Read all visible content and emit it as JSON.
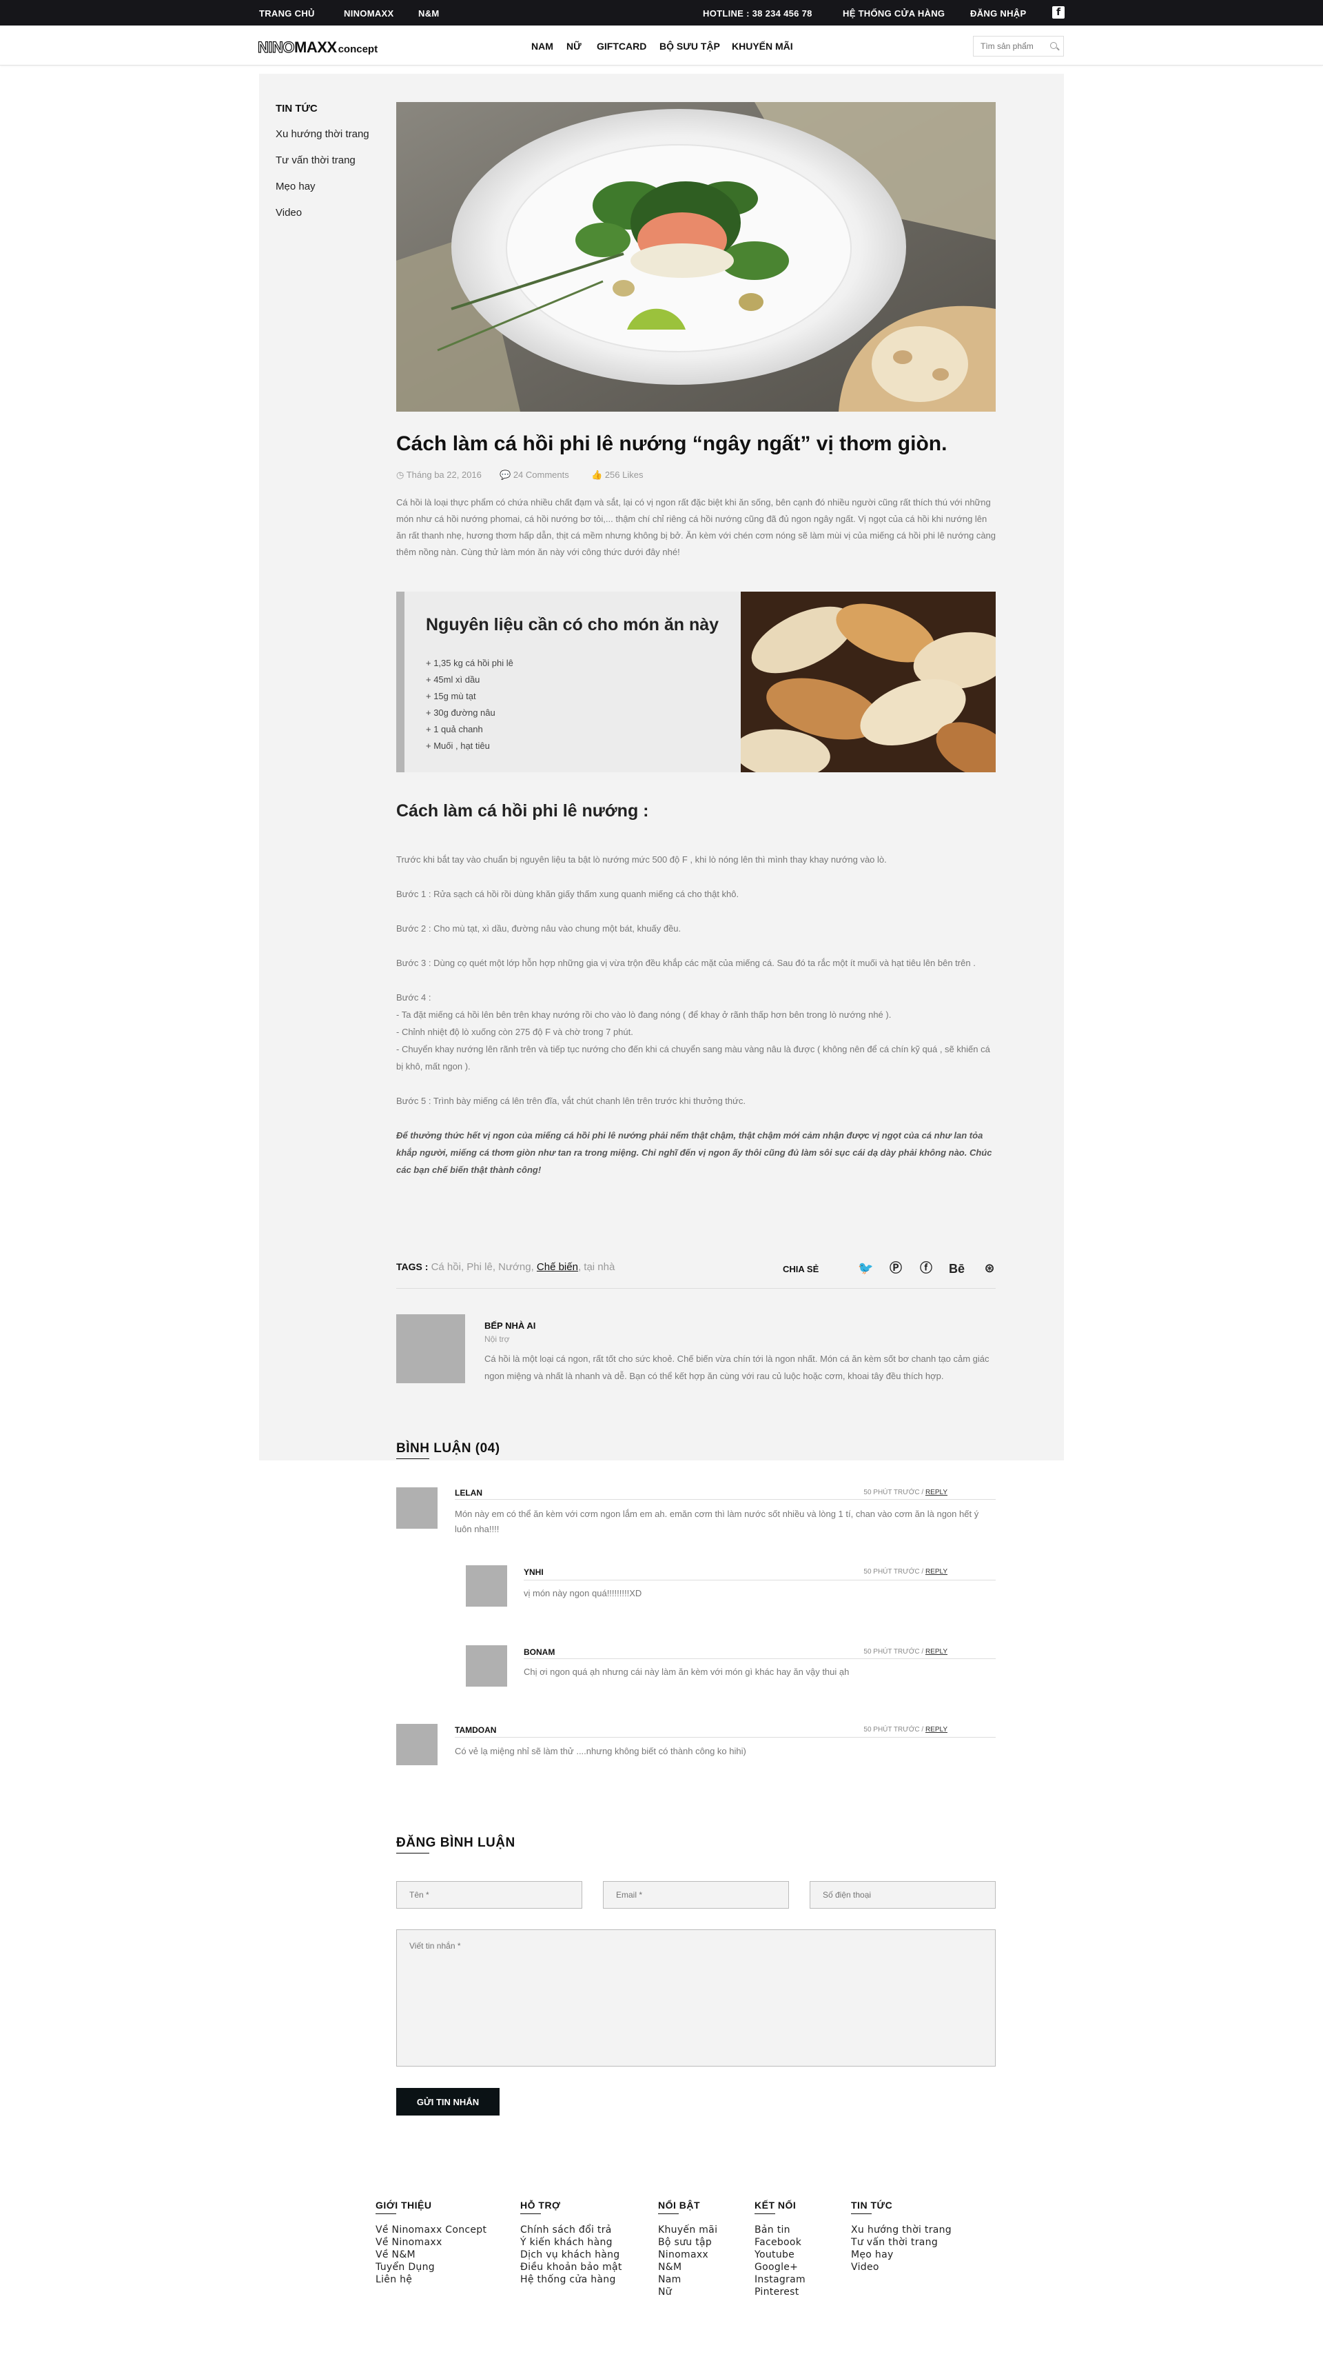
{
  "topbar": {
    "nav": [
      "TRANG CHỦ",
      "NINOMAXX",
      "N&M"
    ],
    "hotline": "HOTLINE : 38 234 456 78",
    "stores": "HỆ THỐNG CỬA HÀNG",
    "login": "ĐĂNG NHẬP",
    "social_icon": "facebook-icon"
  },
  "header": {
    "logo_outline": "NINO",
    "logo_bold": "MAXX",
    "logo_suffix": "concept",
    "nav": [
      "NAM",
      "NỮ",
      "GIFTCARD",
      "BỘ SƯU TẬP",
      "KHUYẾN MÃI"
    ],
    "search_placeholder": "Tìm sản phẩm"
  },
  "sidebar": {
    "title": "TIN TỨC",
    "items": [
      "Xu hướng thời trang",
      "Tư vấn thời trang",
      "Mẹo hay",
      "Video"
    ]
  },
  "article": {
    "title": "Cách làm cá hồi phi lê nướng “ngây ngất” vị thơm giòn.",
    "date": "Tháng ba 22, 2016",
    "comments": "24 Comments",
    "likes": "256 Likes",
    "intro": "Cá hồi là loại thực phẩm có chứa nhiều chất đạm và sắt, lại có vị ngon rất đặc biệt khi ăn sống, bên cạnh đó nhiều người cũng rất thích thú với những món như cá hồi nướng phomai, cá hồi nướng bơ tỏi,... thậm chí chỉ riêng cá hồi nướng cũng đã đủ ngon ngây ngất. Vị ngọt của cá hồi khi nướng lên ăn rất thanh nhẹ, hương thơm hấp dẫn, thịt cá mềm nhưng không bị bở. Ăn kèm với chén cơm nóng sẽ làm mùi vị của miếng cá hồi phi lê nướng càng thêm nồng nàn. Cùng thử làm món ăn này với công thức dưới đây nhé!",
    "ingredients_title": "Nguyên liệu cần có cho món ăn này",
    "ingredients": [
      "+ 1,35 kg cá hồi phi lê",
      "+ 45ml xì dầu",
      "+ 15g mù tạt",
      "+ 30g đường nâu",
      "+ 1 quả chanh",
      "+ Muối , hạt tiêu"
    ],
    "steps_title": "Cách làm cá hồi phi lê nướng :",
    "steps": [
      "Trước khi bắt tay vào chuẩn bị nguyên liệu ta bật lò nướng mức 500 độ F , khi lò nóng lên thì mình thay khay nướng vào lò.",
      "Bước 1 : Rửa sạch cá hồi rồi dùng khăn giấy thấm xung quanh miếng cá cho thật khô.",
      "Bước 2 : Cho mù tạt, xì dầu, đường nâu vào chung một bát, khuấy đều.",
      "Bước 3 : Dùng cọ quét một lớp hỗn hợp những gia vị vừa trộn đều khắp các mặt của miếng cá. Sau đó ta rắc một ít muối và hạt tiêu lên bên trên .",
      "Bước 4 :\n- Ta đặt miếng cá hồi lên bên trên khay nướng rồi cho vào lò đang nóng ( để khay ở rãnh thấp hơn bên trong lò nướng nhé ).\n- Chỉnh nhiệt độ lò xuống còn 275 độ F và chờ trong 7 phút.\n- Chuyển khay nướng lên rãnh trên và tiếp tục nướng cho đến khi cá chuyển sang màu vàng nâu là được ( không nên để cá chín kỹ quá , sẽ khiến cá bị khô, mất ngon ).",
      "Bước 5 : Trình bày miếng cá lên trên đĩa, vắt chút chanh lên trên trước khi thưởng thức."
    ],
    "note": "Để thưởng thức hết vị ngon của miếng cá hồi phi lê nướng phải nếm thật chậm, thật chậm mới cảm nhận được vị ngọt của cá như lan tỏa khắp người, miếng cá thơm giòn như tan ra trong miệng. Chỉ nghĩ đến vị ngon ấy thôi cũng đủ làm sôi sục cái dạ dày phải không nào. Chúc các bạn chế biến thật thành công!",
    "tags_label": "TAGS :",
    "tags": [
      "Cá hồi",
      "Phi lê",
      "Nướng",
      "Chế biến",
      "tại nhà"
    ],
    "share_label": "CHIA SẺ",
    "share_icons": [
      "twitter-icon",
      "pinterest-icon",
      "facebook-icon",
      "behance-icon",
      "dribbble-icon"
    ]
  },
  "author": {
    "name": "BẾP NHÀ AI",
    "role": "Nội trợ",
    "bio": "Cá hồi là một loại cá ngon, rất tốt cho sức khoẻ. Chế biến vừa chín tới là ngon nhất. Món cá ăn kèm sốt bơ chanh tạo cảm giác ngon miệng và nhất là nhanh và dễ. Bạn có thể kết hợp ăn cùng với rau củ luộc hoặc cơm, khoai tây đều thích hợp."
  },
  "comments": {
    "heading": "BÌNH LUẬN (04)",
    "time": "50 PHÚT TRƯỚC /",
    "reply": "REPLY",
    "items": [
      {
        "name": "LELAN",
        "text": "Món này em có thể ăn kèm với cơm ngon lắm em ah. emăn cơm thì làm nước sốt nhiều và lòng 1 tí, chan vào cơm ăn là ngon hết ý luôn nha!!!!"
      },
      {
        "name": "YNHI",
        "text": "vị món này ngon quá!!!!!!!!!XD"
      },
      {
        "name": "BONAM",
        "text": "Chị ơi ngon quá ạh nhưng cái này làm ăn kèm với món gì khác hay ăn vậy thui ạh"
      },
      {
        "name": "TAMDOAN",
        "text": "Có vẻ lạ miệng nhỉ sẽ làm thử ....nhưng không biết có thành công ko hihi)"
      }
    ]
  },
  "comment_form": {
    "heading": "ĐĂNG BÌNH LUẬN",
    "name_placeholder": "Tên *",
    "email_placeholder": "Email *",
    "phone_placeholder": "Số điện thoại",
    "message_placeholder": "Viết tin nhắn *",
    "submit": "GỬI TIN NHẮN"
  },
  "footer": {
    "columns": [
      {
        "title": "GIỚI THIỆU",
        "items": [
          "Về Ninomaxx Concept",
          "Về Ninomaxx",
          "Về N&M",
          "Tuyển Dụng",
          "Liên hệ"
        ]
      },
      {
        "title": "HỖ TRỢ",
        "items": [
          "Chính sách đổi trả",
          "Ý kiến khách hàng",
          "Dịch vụ khách hàng",
          "Điều khoản bảo mật",
          "Hệ thống cửa hàng"
        ]
      },
      {
        "title": "NỔI BẬT",
        "items": [
          "Khuyến mãi",
          "Bộ sưu tập",
          "Ninomaxx",
          "N&M",
          "Nam",
          "Nữ"
        ]
      },
      {
        "title": "KẾT NỐI",
        "items": [
          "Bản tin",
          "Facebook",
          "Youtube",
          "Google+",
          "Instagram",
          "Pinterest"
        ]
      },
      {
        "title": "TIN TỨC",
        "items": [
          "Xu hướng thời trang",
          "Tư vấn thời trang",
          "Mẹo hay",
          "Video"
        ]
      }
    ]
  }
}
